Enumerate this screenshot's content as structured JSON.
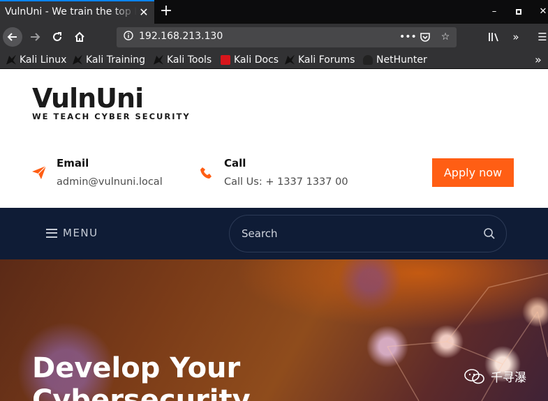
{
  "browser": {
    "tab_title": "VulnUni - We train the top Information",
    "url": "192.168.213.130",
    "bookmarks": [
      {
        "label": "Kali Linux"
      },
      {
        "label": "Kali Training"
      },
      {
        "label": "Kali Tools"
      },
      {
        "label": "Kali Docs"
      },
      {
        "label": "Kali Forums"
      },
      {
        "label": "NetHunter"
      }
    ]
  },
  "site": {
    "logo": "VulnUni",
    "tagline": "WE TEACH CYBER SECURITY",
    "contacts": [
      {
        "label": "Email",
        "value": "admin@vulnuni.local",
        "icon": "paper-plane-icon"
      },
      {
        "label": "Call",
        "value": "Call Us: + 1337 1337 00",
        "icon": "phone-icon"
      }
    ],
    "apply_label": "Apply now",
    "menu_label": "MENU",
    "search_placeholder": "Search",
    "hero_title": "Develop Your Cybersecurity",
    "watermark": "千寻瀑"
  },
  "colors": {
    "accent": "#ff5e14",
    "nav_bg": "#0f1c36",
    "browser_dark": "#0c0c0d",
    "browser_toolbar": "#323234",
    "tab_highlight": "#0a84ff"
  }
}
